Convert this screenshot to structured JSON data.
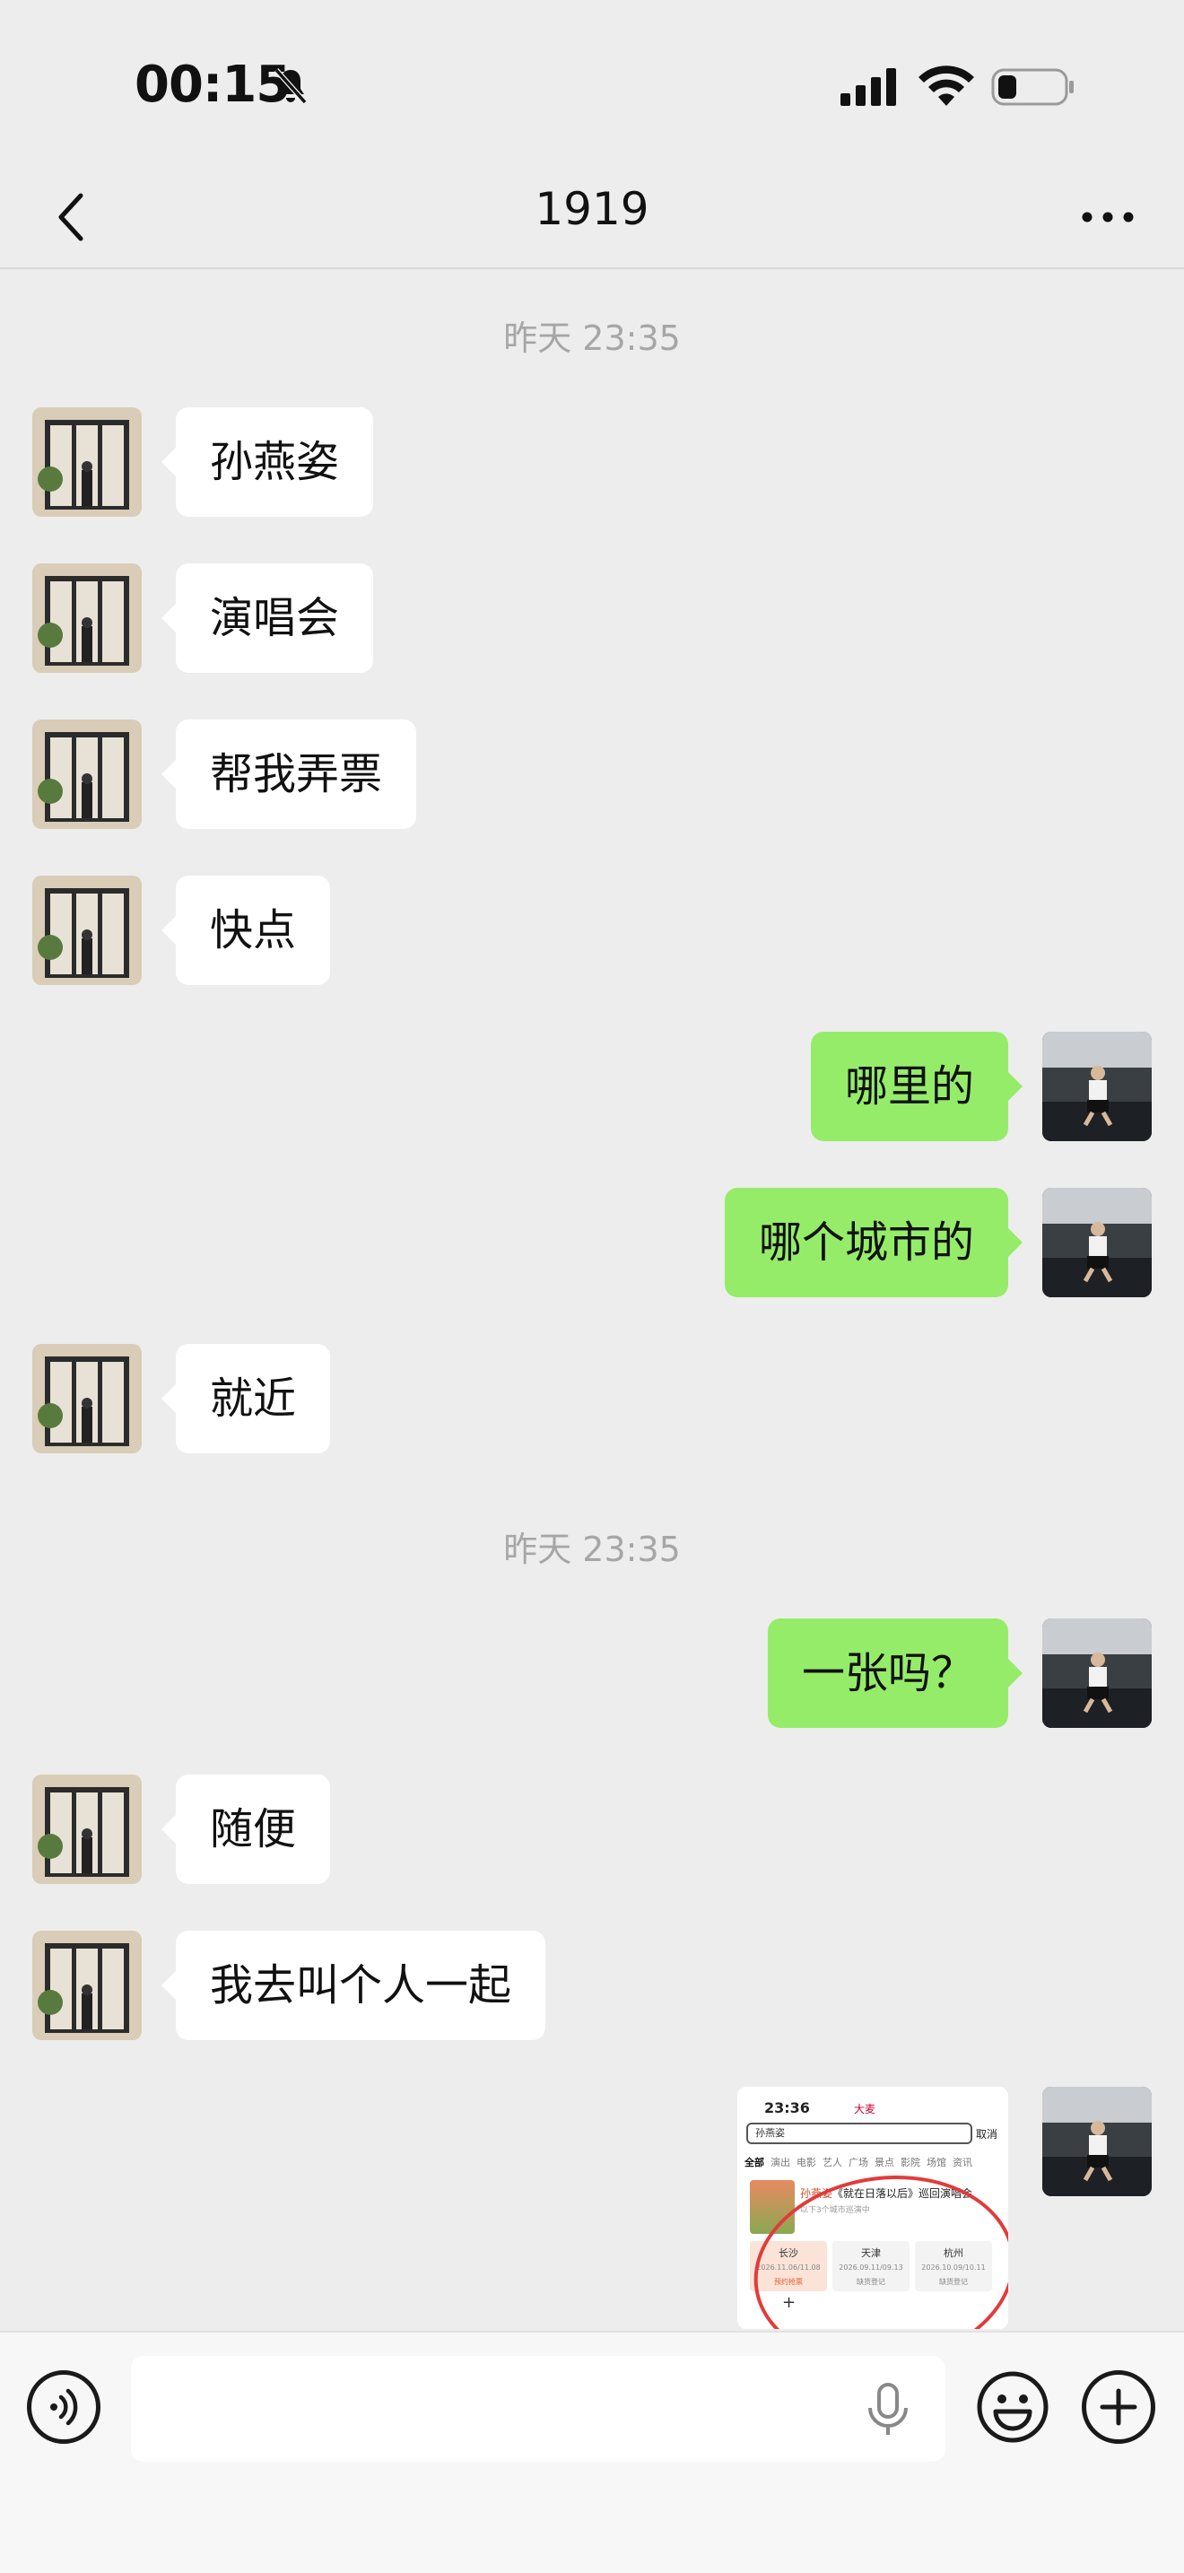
{
  "status_bar": {
    "time": "00:15",
    "icons": [
      "bell-off-icon",
      "signal-icon",
      "wifi-icon",
      "battery-icon"
    ]
  },
  "header": {
    "title": "1919",
    "back_icon": "chevron-left-icon",
    "more_icon": "more-icon"
  },
  "chat": {
    "timestamps": [
      "昨天 23:35",
      "昨天 23:35"
    ],
    "messages": [
      {
        "side": "left",
        "text": "孙燕姿"
      },
      {
        "side": "left",
        "text": "演唱会"
      },
      {
        "side": "left",
        "text": "帮我弄票"
      },
      {
        "side": "left",
        "text": "快点"
      },
      {
        "side": "right",
        "text": "哪里的"
      },
      {
        "side": "right",
        "text": "哪个城市的"
      },
      {
        "side": "left",
        "text": "就近"
      },
      {
        "side": "right",
        "text": "一张吗？"
      },
      {
        "side": "left",
        "text": "随便"
      },
      {
        "side": "left",
        "text": "我去叫个人一起"
      },
      {
        "side": "right",
        "type": "image"
      }
    ]
  },
  "image_message": {
    "status_time": "23:36",
    "brand": "大麦",
    "search_text": "孙燕姿",
    "cancel": "取消",
    "tabs": [
      "全部",
      "演出",
      "电影",
      "艺人",
      "广场",
      "景点",
      "影院",
      "场馆",
      "资讯"
    ],
    "concert_title_artist": "孙燕姿",
    "concert_title_rest": "《就在日落以后》巡回演唱会",
    "concert_sub": "以下3个城市巡演中",
    "cities": [
      {
        "name": "长沙",
        "date": "2026.11.06/11.08",
        "status": "预约抢票"
      },
      {
        "name": "天津",
        "date": "2026.09.11/09.13",
        "status": "缺货登记"
      },
      {
        "name": "杭州",
        "date": "2026.10.09/10.11",
        "status": "缺货登记"
      }
    ]
  },
  "input_bar": {
    "placeholder": "",
    "icons": [
      "voice-icon",
      "mic-icon",
      "emoji-icon",
      "plus-icon"
    ]
  },
  "colors": {
    "background": "#ededed",
    "bubble_self": "#95ec69",
    "bubble_other": "#ffffff",
    "timestamp": "#a6a6a6"
  }
}
